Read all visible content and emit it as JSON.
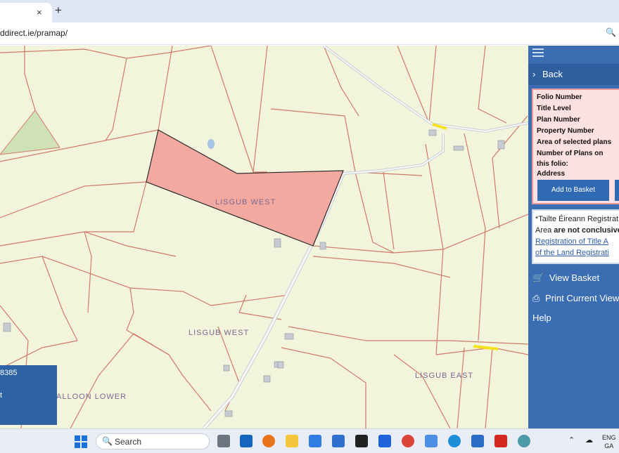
{
  "browser": {
    "tab_close": "×",
    "new_tab": "+",
    "url": "ddirect.ie/pramap/",
    "zoom_icon": "zoom-icon"
  },
  "map": {
    "labels": [
      "LISGUB WEST",
      "LISGUB WEST",
      "LISGUB EAST",
      "ALLOON LOWER"
    ],
    "overlay": {
      "line1": "8385",
      "line2": "t"
    },
    "colors": {
      "parcel_fill": "#f4a9a0",
      "boundary": "#d27a6a",
      "road": "#c9cdd3",
      "highlight": "#f5e21e"
    }
  },
  "sidebar": {
    "back_label": "Back",
    "info_rows": [
      "Folio Number",
      "Title Level",
      "Plan Number",
      "Property Number",
      "Area of selected plans",
      "Number of Plans on",
      "this folio:",
      "Address"
    ],
    "add_to_basket": "Add to Basket",
    "disclaimer": {
      "line1": "*Tailte Éireann Registrat",
      "line2_a": "Area ",
      "line2_b": "are not conclusive",
      "link1": "Registration of Title A",
      "link2": "of the Land Registrati"
    },
    "view_basket": "View Basket",
    "print_view": "Print Current View",
    "help": "Help"
  },
  "taskbar": {
    "search_placeholder": "Search",
    "lang_top": "ENG",
    "lang_bottom": "GA"
  }
}
